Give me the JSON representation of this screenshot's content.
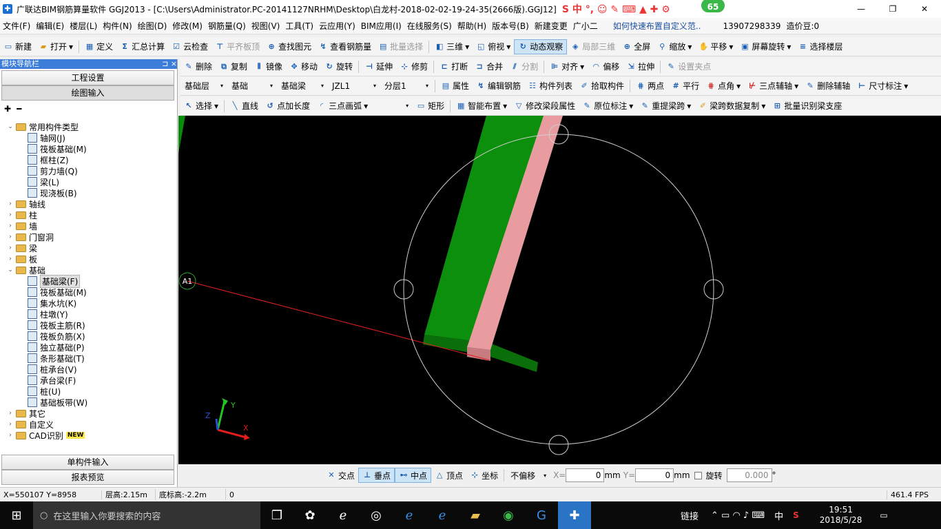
{
  "window": {
    "title": "广联达BIM钢筋算量软件 GGJ2013 - [C:\\Users\\Administrator.PC-20141127NRHM\\Desktop\\白龙村-2018-02-02-19-24-35(2666版).GGJ12]",
    "badge": "65",
    "minimize": "—",
    "maximize": "❐",
    "close": "✕"
  },
  "menu": [
    "文件(F)",
    "编辑(E)",
    "楼层(L)",
    "构件(N)",
    "绘图(D)",
    "修改(M)",
    "钢筋量(Q)",
    "视图(V)",
    "工具(T)",
    "云应用(Y)",
    "BIM应用(I)",
    "在线服务(S)",
    "帮助(H)",
    "版本号(B)",
    "新建变更",
    "广小二",
    "如何快速布置自定义范..",
    "13907298339",
    "造价豆:0"
  ],
  "toolbar1": [
    "新建",
    "打开",
    "定义",
    "汇总计算",
    "云检查",
    "平齐板顶",
    "查找图元",
    "查看钢筋量",
    "批量选择",
    "三维",
    "俯视",
    "动态观察",
    "局部三维",
    "全屏",
    "缩放",
    "平移",
    "屏幕旋转",
    "选择楼层"
  ],
  "toolbar2": [
    "删除",
    "复制",
    "镜像",
    "移动",
    "旋转",
    "延伸",
    "修剪",
    "打断",
    "合并",
    "分割",
    "对齐",
    "偏移",
    "拉伸",
    "设置夹点"
  ],
  "toolbar3": {
    "combos": [
      "基础层",
      "基础",
      "基础梁",
      "JZL1",
      "分层1"
    ],
    "buttons": [
      "属性",
      "编辑钢筋",
      "构件列表",
      "拾取构件",
      "两点",
      "平行",
      "点角",
      "三点辅轴",
      "删除辅轴",
      "尺寸标注"
    ]
  },
  "toolbar4": [
    "选择",
    "直线",
    "点加长度",
    "三点画弧",
    "矩形",
    "智能布置",
    "修改梁段属性",
    "原位标注",
    "重提梁跨",
    "梁跨数据复制",
    "批量识别梁支座"
  ],
  "sidebar": {
    "title": "模块导航栏",
    "pin": "⊐ ×",
    "btn_project": "工程设置",
    "btn_draw": "绘图输入",
    "btn_single": "单构件输入",
    "btn_report": "报表预览"
  },
  "tree": [
    {
      "t": "常用构件类型",
      "lvl": 0,
      "exp": "⌄",
      "type": "folder"
    },
    {
      "t": "轴网(J)",
      "lvl": 1,
      "type": "comp"
    },
    {
      "t": "筏板基础(M)",
      "lvl": 1,
      "type": "comp"
    },
    {
      "t": "框柱(Z)",
      "lvl": 1,
      "type": "comp"
    },
    {
      "t": "剪力墙(Q)",
      "lvl": 1,
      "type": "comp"
    },
    {
      "t": "梁(L)",
      "lvl": 1,
      "type": "comp"
    },
    {
      "t": "现浇板(B)",
      "lvl": 1,
      "type": "comp"
    },
    {
      "t": "轴线",
      "lvl": 0,
      "exp": "›",
      "type": "folder"
    },
    {
      "t": "柱",
      "lvl": 0,
      "exp": "›",
      "type": "folder"
    },
    {
      "t": "墙",
      "lvl": 0,
      "exp": "›",
      "type": "folder"
    },
    {
      "t": "门窗洞",
      "lvl": 0,
      "exp": "›",
      "type": "folder"
    },
    {
      "t": "梁",
      "lvl": 0,
      "exp": "›",
      "type": "folder"
    },
    {
      "t": "板",
      "lvl": 0,
      "exp": "›",
      "type": "folder"
    },
    {
      "t": "基础",
      "lvl": 0,
      "exp": "⌄",
      "type": "folder"
    },
    {
      "t": "基础梁(F)",
      "lvl": 1,
      "type": "comp",
      "sel": true
    },
    {
      "t": "筏板基础(M)",
      "lvl": 1,
      "type": "comp"
    },
    {
      "t": "集水坑(K)",
      "lvl": 1,
      "type": "comp"
    },
    {
      "t": "柱墩(Y)",
      "lvl": 1,
      "type": "comp"
    },
    {
      "t": "筏板主筋(R)",
      "lvl": 1,
      "type": "comp"
    },
    {
      "t": "筏板负筋(X)",
      "lvl": 1,
      "type": "comp"
    },
    {
      "t": "独立基础(P)",
      "lvl": 1,
      "type": "comp"
    },
    {
      "t": "条形基础(T)",
      "lvl": 1,
      "type": "comp"
    },
    {
      "t": "桩承台(V)",
      "lvl": 1,
      "type": "comp"
    },
    {
      "t": "承台梁(F)",
      "lvl": 1,
      "type": "comp"
    },
    {
      "t": "桩(U)",
      "lvl": 1,
      "type": "comp"
    },
    {
      "t": "基础板带(W)",
      "lvl": 1,
      "type": "comp"
    },
    {
      "t": "其它",
      "lvl": 0,
      "exp": "›",
      "type": "folder"
    },
    {
      "t": "自定义",
      "lvl": 0,
      "exp": "›",
      "type": "folder"
    },
    {
      "t": "CAD识别",
      "lvl": 0,
      "exp": "›",
      "type": "folder",
      "tag": "NEW"
    }
  ],
  "canvas": {
    "axis_label": "A1",
    "x": "X",
    "y": "Y",
    "z": "Z"
  },
  "snap": {
    "buttons": [
      "交点",
      "垂点",
      "中点",
      "顶点",
      "坐标"
    ],
    "offset": "不偏移",
    "x_label": "X=",
    "x_val": "0",
    "y_label": "Y=",
    "y_val": "0",
    "unit": "mm",
    "rot_label": "旋转",
    "rot_val": "0.000",
    "deg": "°"
  },
  "status": {
    "coord": "X=550107 Y=8958",
    "floor_h": "层高:2.15m",
    "base_h": "底标高:-2.2m",
    "val": "0",
    "fps": "461.4 FPS"
  },
  "taskbar": {
    "search": "在这里输入你要搜索的内容",
    "link": "链接",
    "ime": "中",
    "time": "19:51",
    "date": "2018/5/28"
  }
}
